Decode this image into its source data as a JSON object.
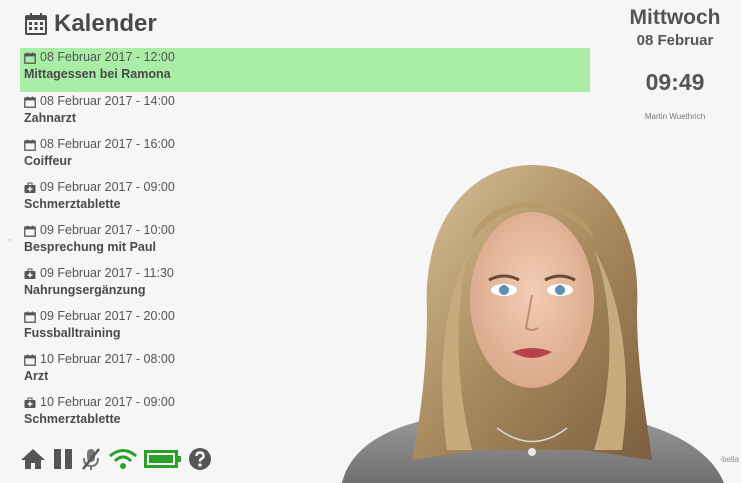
{
  "header": {
    "title": "Kalender",
    "icon": "calendar-icon"
  },
  "date_panel": {
    "weekday": "Mittwoch",
    "date": "08 Februar",
    "time": "09:49",
    "author": "Martin Wuethrich"
  },
  "events": [
    {
      "date": "08 Februar 2017 - 12:00",
      "title": "Mittagessen bei Ramona",
      "icon": "calendar-icon",
      "active": true
    },
    {
      "date": "08 Februar 2017 - 14:00",
      "title": "Zahnarzt",
      "icon": "calendar-icon"
    },
    {
      "date": "08 Februar 2017 - 16:00",
      "title": "Coiffeur",
      "icon": "calendar-icon"
    },
    {
      "date": "09 Februar 2017 - 09:00",
      "title": "Schmerztablette",
      "icon": "medkit-icon"
    },
    {
      "date": "09 Februar 2017 - 10:00",
      "title": "Besprechung mit Paul",
      "icon": "calendar-icon"
    },
    {
      "date": "09 Februar 2017 - 11:30",
      "title": "Nahrungsergänzung",
      "icon": "medkit-icon"
    },
    {
      "date": "09 Februar 2017 - 20:00",
      "title": "Fussballtraining",
      "icon": "calendar-icon"
    },
    {
      "date": "10 Februar 2017 - 08:00",
      "title": "Arzt",
      "icon": "calendar-icon"
    },
    {
      "date": "10 Februar 2017 - 09:00",
      "title": "Schmerztablette",
      "icon": "medkit-icon"
    }
  ],
  "toolbar": {
    "icons": [
      "home-icon",
      "pause-icon",
      "microphone-muted-icon",
      "wifi-icon",
      "battery-icon",
      "help-icon"
    ]
  },
  "watermark": "-bella",
  "colors": {
    "active_event": "#a9eda6",
    "wifi": "#2aa02a",
    "battery": "#2aa02a",
    "icon": "#555555"
  }
}
